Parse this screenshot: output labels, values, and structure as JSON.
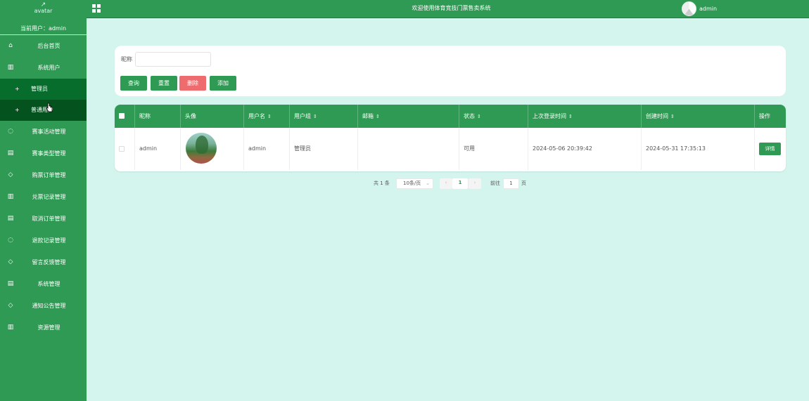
{
  "sidebar": {
    "avatar_alt": "avatar",
    "current_user": "当前用户：admin",
    "items": [
      {
        "label": "后台首页",
        "icon": "home-icon"
      },
      {
        "label": "系统用户",
        "icon": "columns-icon"
      },
      {
        "label": "赛事活动管理",
        "icon": "chat-icon"
      },
      {
        "label": "赛事类型管理",
        "icon": "document-icon"
      },
      {
        "label": "购票订单管理",
        "icon": "shield-icon"
      },
      {
        "label": "兑票记录管理",
        "icon": "columns-icon"
      },
      {
        "label": "取消订单管理",
        "icon": "document-icon"
      },
      {
        "label": "退款记录管理",
        "icon": "chat-icon"
      },
      {
        "label": "留言反馈管理",
        "icon": "shield-icon"
      },
      {
        "label": "系统管理",
        "icon": "document-icon"
      },
      {
        "label": "通知公告管理",
        "icon": "shield-icon"
      },
      {
        "label": "资源管理",
        "icon": "columns-icon"
      }
    ],
    "submenu": [
      {
        "label": "管理员"
      },
      {
        "label": "普通用户"
      }
    ]
  },
  "header": {
    "title": "欢迎使用体育竞技门票售卖系统",
    "user": "admin"
  },
  "search": {
    "nickname_label": "昵称",
    "nickname_value": "",
    "buttons": {
      "query": "查询",
      "reset": "重置",
      "delete": "删除",
      "add": "添加"
    }
  },
  "table": {
    "columns": [
      "昵称",
      "头像",
      "用户名",
      "用户组",
      "邮箱",
      "状态",
      "上次登录时间",
      "创建时间",
      "操作"
    ],
    "sort_glyph": "⇕",
    "rows": [
      {
        "nickname": "admin",
        "username": "admin",
        "group": "管理员",
        "email": "",
        "status": "可用",
        "last_login": "2024-05-06 20:39:42",
        "created": "2024-05-31 17:35:13",
        "action": "详情"
      }
    ]
  },
  "pagination": {
    "total": "共 1 条",
    "page_size": "10条/页",
    "current_page": "1",
    "goto_label": "前往",
    "goto_value": "1",
    "page_unit": "页"
  },
  "colors": {
    "primary": "#2e9a53",
    "sidebar_sub": "#066d2c",
    "sidebar_active": "#04531f",
    "danger": "#ee6b6e",
    "background": "#d4f5ee"
  }
}
